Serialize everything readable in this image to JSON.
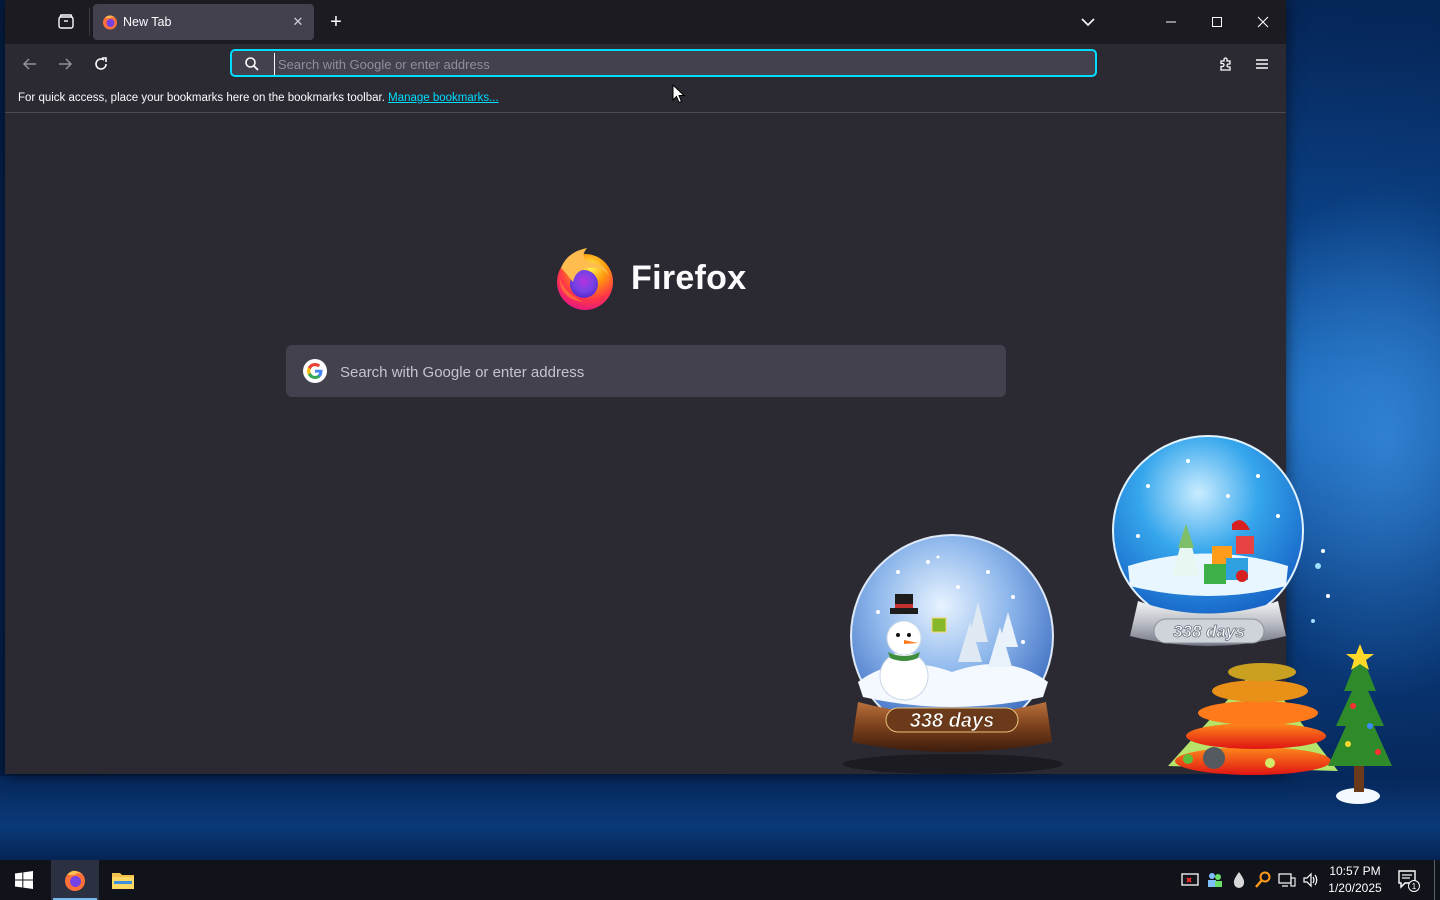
{
  "browser": {
    "tab": {
      "title": "New Tab"
    },
    "urlbar": {
      "placeholder": "Search with Google or enter address"
    },
    "bookmarks_bar": {
      "message": "For quick access, place your bookmarks here on the bookmarks toolbar.",
      "link_label": "Manage bookmarks..."
    },
    "newtab": {
      "brand": "Firefox",
      "search_placeholder": "Search with Google or enter address"
    },
    "colors": {
      "accent": "#00ddff",
      "toolbar": "#2b2a33",
      "frame": "#1c1b22"
    }
  },
  "gadgets": {
    "snowglobe_small": {
      "label": "338 days"
    },
    "snowglobe_large": {
      "label": "338 days"
    }
  },
  "taskbar": {
    "apps": [
      {
        "name": "Firefox",
        "icon": "firefox-icon",
        "active": true
      },
      {
        "name": "File Explorer",
        "icon": "folder-icon",
        "active": false
      }
    ],
    "clock": {
      "time": "10:57 PM",
      "date": "1/20/2025"
    },
    "notification_count": "1",
    "tray_icons": [
      "security-icon",
      "network-people-icon",
      "drop-icon",
      "search-key-icon",
      "network-icon",
      "volume-icon"
    ]
  }
}
